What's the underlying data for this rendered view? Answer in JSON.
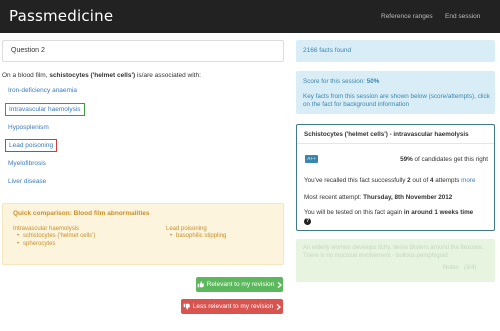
{
  "header": {
    "brand": "Passmedicine",
    "nav": [
      "Reference ranges",
      "End session"
    ]
  },
  "question": {
    "title": "Question 2",
    "prompt_prefix": "On a blood film, ",
    "prompt_bold": "schistocytes ('helmet cells')",
    "prompt_suffix": " is/are associated with:",
    "options": [
      "Iron-deficiency anaemia",
      "Intravascular haemolysis",
      "Hyposplenism",
      "Lead poisoning",
      "Myelofibrosis",
      "Liver disease"
    ]
  },
  "comparison": {
    "title": "Quick comparison: Blood film abnormalities",
    "left_heading": "Intravascular haemolysis",
    "left_items": [
      "schistocytes ('helmet cells')",
      "spherocytes"
    ],
    "right_heading": "Lead poisoning",
    "right_items": [
      "basophilic stippling"
    ]
  },
  "buttons": {
    "relevant": "Relevant to my revision",
    "less_relevant": "Less relevant to my revision"
  },
  "sidebar": {
    "facts_found": "2166 facts found",
    "score_label": "Score for this session: ",
    "score_value": "50%",
    "key_facts": "Key facts from this session are shown below (score/attempts), click on the fact for background information"
  },
  "fact": {
    "title": "Schistocytes ('helmet cells') - intravascular haemolysis",
    "badge": "A++",
    "percent": "59%",
    "percent_text": " of candidates get this right",
    "recall_prefix": "You've recalled this fact successfully ",
    "recall_success": "2",
    "recall_mid": " out of ",
    "recall_attempts": "4",
    "recall_suffix": " attempts ",
    "more": "more",
    "attempt_prefix": "Most recent attempt: ",
    "attempt_date": "Thursday, 8th November 2012",
    "again_prefix": "You will be tested on this fact again ",
    "again_bold": "in around 1 weeks time"
  },
  "next_fact": {
    "text": "An elderly women develops itchy, tense blisters around the flexures. There is no mucosal involvement - bullous pemphigoid",
    "notes": "Notes",
    "count": "(3/4)"
  },
  "colors": {
    "correct_border": "#3c9b3c",
    "wrong_border": "#d9363e",
    "link": "#3a7bbf",
    "info_bg": "#d9edf7",
    "warning_bg": "#fcf4dc"
  }
}
